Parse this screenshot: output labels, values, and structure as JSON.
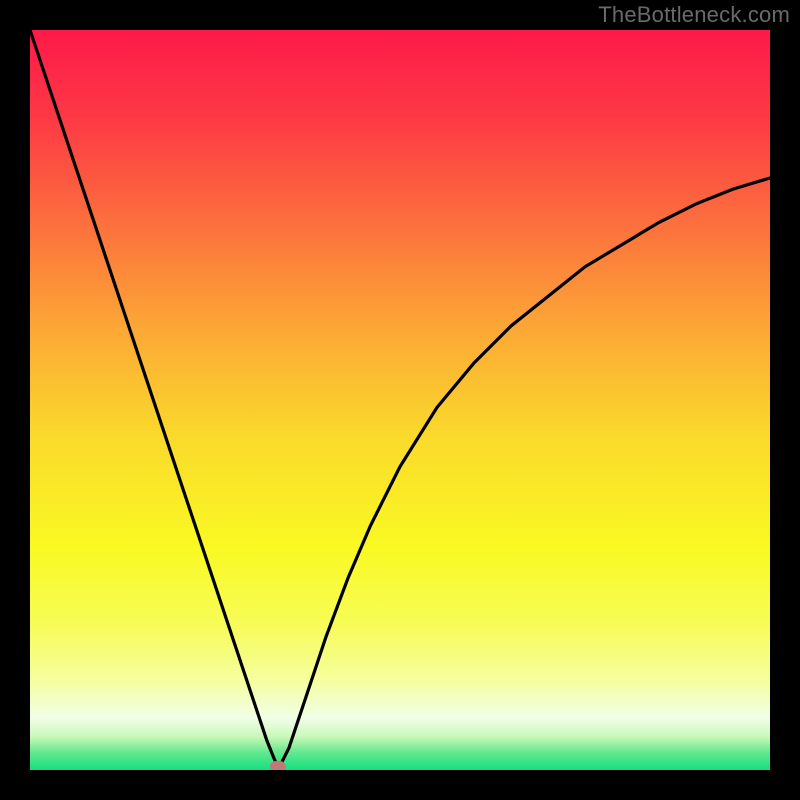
{
  "watermark": "TheBottleneck.com",
  "chart_data": {
    "type": "line",
    "title": "",
    "xlabel": "",
    "ylabel": "",
    "xlim": [
      0,
      100
    ],
    "ylim": [
      0,
      100
    ],
    "grid": false,
    "series": [
      {
        "name": "bottleneck-curve",
        "x": [
          0,
          3,
          6,
          9,
          12,
          15,
          18,
          21,
          24,
          27,
          30,
          32,
          33,
          33.5,
          34,
          35,
          36,
          38,
          40,
          43,
          46,
          50,
          55,
          60,
          65,
          70,
          75,
          80,
          85,
          90,
          95,
          100
        ],
        "y": [
          100,
          91,
          82,
          73,
          64,
          55,
          46,
          37,
          28,
          19,
          10,
          4,
          1.5,
          0.5,
          1,
          3,
          6,
          12,
          18,
          26,
          33,
          41,
          49,
          55,
          60,
          64,
          68,
          71,
          74,
          76.5,
          78.5,
          80
        ],
        "color": "#000000"
      }
    ],
    "markers": [
      {
        "name": "optimum-point",
        "x": 33.5,
        "y": 0.5,
        "color": "#c07878"
      }
    ],
    "background_gradient": {
      "stops": [
        {
          "offset": 0.0,
          "color": "#fd1a49"
        },
        {
          "offset": 0.12,
          "color": "#fd3945"
        },
        {
          "offset": 0.25,
          "color": "#fc6b3e"
        },
        {
          "offset": 0.4,
          "color": "#fca636"
        },
        {
          "offset": 0.55,
          "color": "#fada2b"
        },
        {
          "offset": 0.7,
          "color": "#f9f923"
        },
        {
          "offset": 0.8,
          "color": "#f7fc55"
        },
        {
          "offset": 0.88,
          "color": "#f6fea0"
        },
        {
          "offset": 0.93,
          "color": "#f0ffe8"
        },
        {
          "offset": 0.955,
          "color": "#caf8b8"
        },
        {
          "offset": 0.975,
          "color": "#69e990"
        },
        {
          "offset": 1.0,
          "color": "#14df81"
        }
      ]
    }
  }
}
